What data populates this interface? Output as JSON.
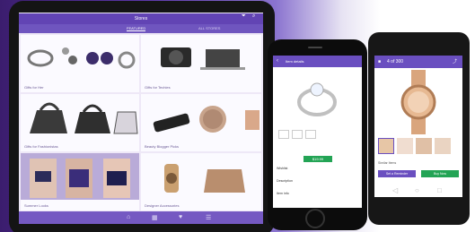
{
  "ipad": {
    "title": "Stores",
    "tabs": [
      "",
      "FEATURED",
      "ALL STORES"
    ],
    "tiles": [
      {
        "caption": "Gifts for Her"
      },
      {
        "caption": "Gifts for Techies"
      },
      {
        "caption": "Gifts for Fashionistas"
      },
      {
        "caption": "Beauty Blogger Picks"
      },
      {
        "caption": "Summer Looks"
      },
      {
        "caption": "Designer Accessories"
      }
    ],
    "nav": [
      "Home",
      "Stores",
      "Watch",
      "Cart"
    ]
  },
  "iphone": {
    "title": "Item details",
    "price": "$19.99",
    "sections": [
      "Wishlist",
      "Description",
      "Item info"
    ]
  },
  "android": {
    "counter": "4 of 300",
    "thumbs_label": "Similar Items",
    "buttons": [
      "Set a Reminder",
      "Buy Now"
    ]
  },
  "colors": {
    "purple": "#6a4fc0",
    "green": "#23a455"
  }
}
